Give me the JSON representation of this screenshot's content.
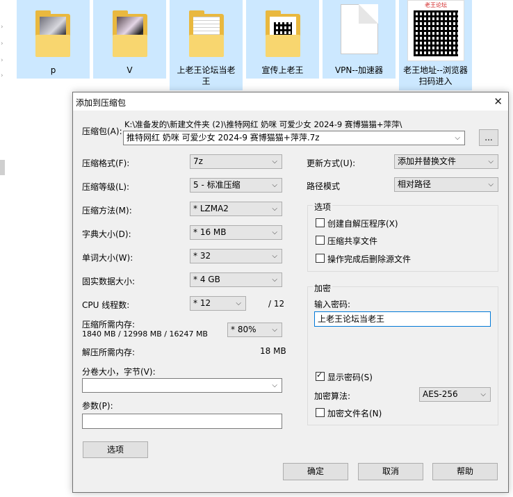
{
  "explorer": {
    "tiles": [
      {
        "label": "p"
      },
      {
        "label": "V"
      },
      {
        "label": "上老王论坛当老王"
      },
      {
        "label": "宣传上老王"
      },
      {
        "label": "VPN--加速器"
      },
      {
        "label": "老王地址--浏览器扫码进入",
        "qr_header": "老王论坛"
      }
    ]
  },
  "dialog": {
    "title": "添加到压缩包",
    "archive_label": "压缩包(A):",
    "archive_path": "K:\\准备发的\\新建文件夹 (2)\\推特网红 奶咪 可爱少女 2024-9 赛博猫猫+萍萍\\",
    "archive_name": "推特网红 奶咪 可爱少女 2024-9 赛博猫猫+萍萍.7z",
    "browse_label": "...",
    "format_label": "压缩格式(F):",
    "format_value": "7z",
    "level_label": "压缩等级(L):",
    "level_value": "5 - 标准压缩",
    "method_label": "压缩方法(M):",
    "method_value": "* LZMA2",
    "dict_label": "字典大小(D):",
    "dict_value": "* 16 MB",
    "word_label": "单词大小(W):",
    "word_value": "* 32",
    "solid_label": "固实数据大小:",
    "solid_value": "* 4 GB",
    "threads_label": "CPU 线程数:",
    "threads_value": "* 12",
    "threads_total": "/ 12",
    "mem_label": "压缩所需内存:",
    "mem_detail": "1840 MB / 12998 MB / 16247 MB",
    "mem_percent": "* 80%",
    "decomp_label": "解压所需内存:",
    "decomp_value": "18 MB",
    "volume_label": "分卷大小，字节(V):",
    "volume_value": "",
    "params_label": "参数(P):",
    "params_value": "",
    "options_button": "选项",
    "update_label": "更新方式(U):",
    "update_value": "添加并替换文件",
    "path_label": "路径模式",
    "path_value": "相对路径",
    "options_group": "选项",
    "opt_sfx": "创建自解压程序(X)",
    "opt_shared": "压缩共享文件",
    "opt_delete": "操作完成后删除源文件",
    "encrypt_group": "加密",
    "password_label": "输入密码:",
    "password_value": "上老王论坛当老王",
    "show_password": "显示密码(S)",
    "enc_method_label": "加密算法:",
    "enc_method_value": "AES-256",
    "encrypt_names": "加密文件名(N)",
    "ok": "确定",
    "cancel": "取消",
    "help": "帮助"
  }
}
